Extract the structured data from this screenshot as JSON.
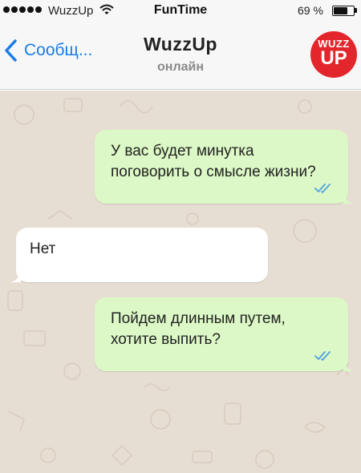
{
  "status_bar": {
    "carrier": "WuzzUp",
    "time": "FunTime",
    "battery_percent": "69 %",
    "battery_level": 0.69
  },
  "nav": {
    "back_label": "Сообщ...",
    "chat_title": "WuzzUp",
    "chat_status": "онлайн",
    "avatar_top": "WUZZ",
    "avatar_bottom": "UP"
  },
  "messages": [
    {
      "direction": "outgoing",
      "text": "У вас будет минутка поговорить о смысле жизни?",
      "read": true
    },
    {
      "direction": "incoming",
      "text": "Нет"
    },
    {
      "direction": "outgoing",
      "text": "Пойдем длинным путем, хотите выпить?",
      "read": true
    }
  ],
  "colors": {
    "accent": "#1a7ee6",
    "outgoing_bubble": "#dcf8c6",
    "incoming_bubble": "#ffffff",
    "chat_background": "#e7ded3",
    "avatar": "#e3262b",
    "read_checks": "#4fa3e0"
  }
}
